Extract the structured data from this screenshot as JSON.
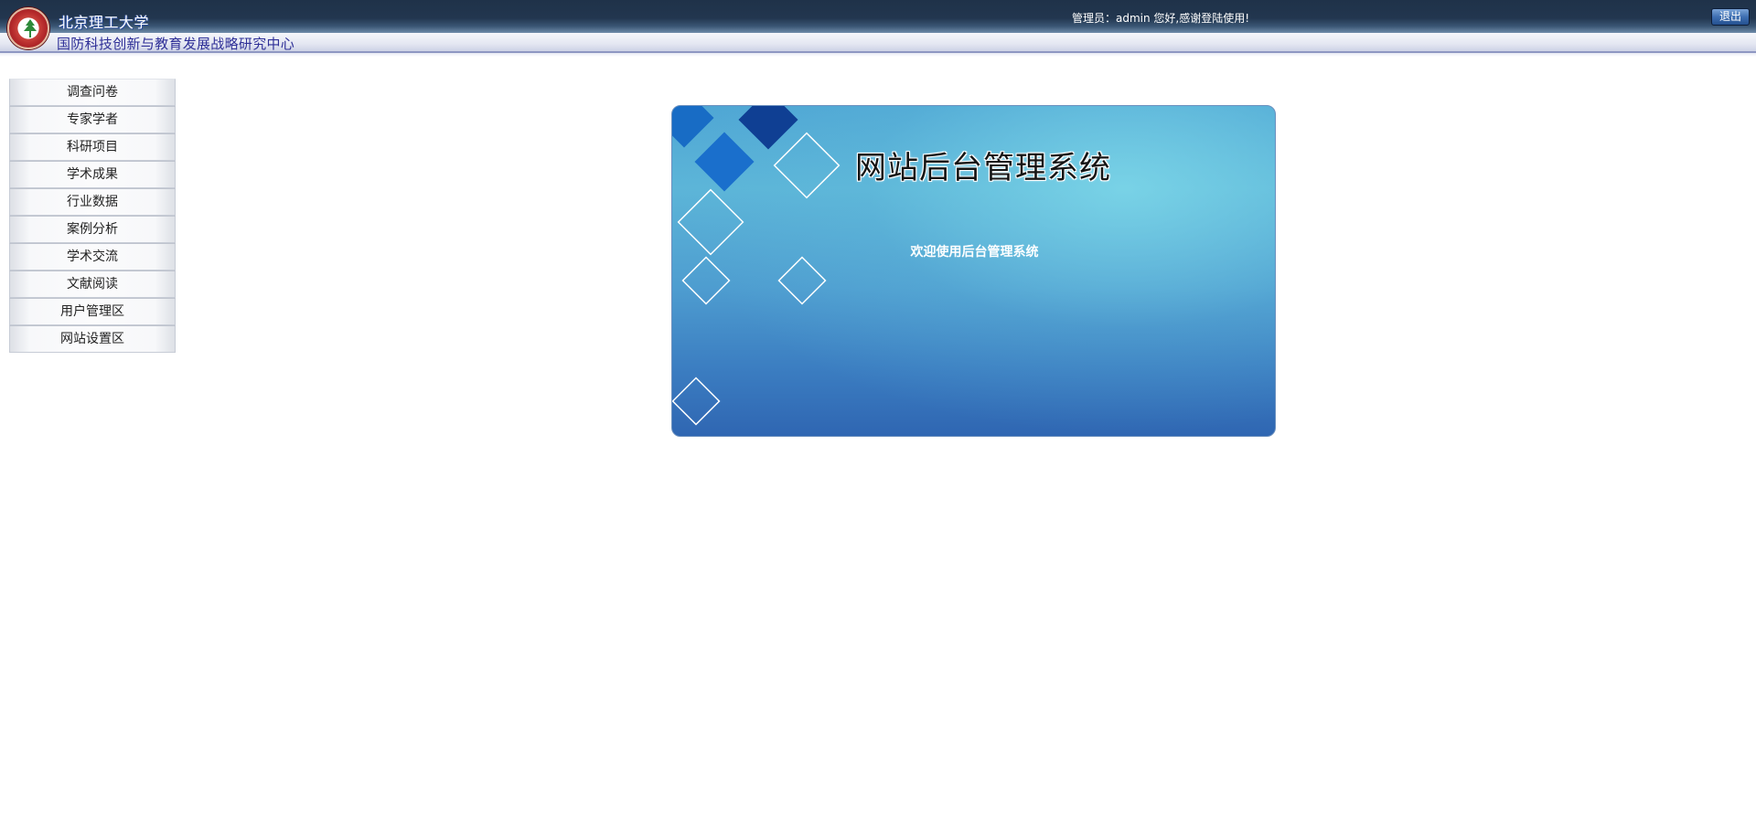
{
  "header": {
    "university": "北京理工大学",
    "center": "国防科技创新与教育发展战略研究中心",
    "welcome": "管理员：admin 您好,感谢登陆使用!",
    "logout_label": "退出",
    "logo_icon": "university-seal-icon"
  },
  "sidebar": {
    "items": [
      {
        "label": "调查问卷"
      },
      {
        "label": "专家学者"
      },
      {
        "label": "科研项目"
      },
      {
        "label": "学术成果"
      },
      {
        "label": "行业数据"
      },
      {
        "label": "案例分析"
      },
      {
        "label": "学术交流"
      },
      {
        "label": "文献阅读"
      },
      {
        "label": "用户管理区"
      },
      {
        "label": "网站设置区"
      }
    ]
  },
  "main": {
    "title": "网站后台管理系统",
    "subtitle": "欢迎使用后台管理系统"
  },
  "colors": {
    "header_dark": "#1f3249",
    "banner_blue": "#4fa6d4",
    "center_text": "#2e2f97"
  }
}
